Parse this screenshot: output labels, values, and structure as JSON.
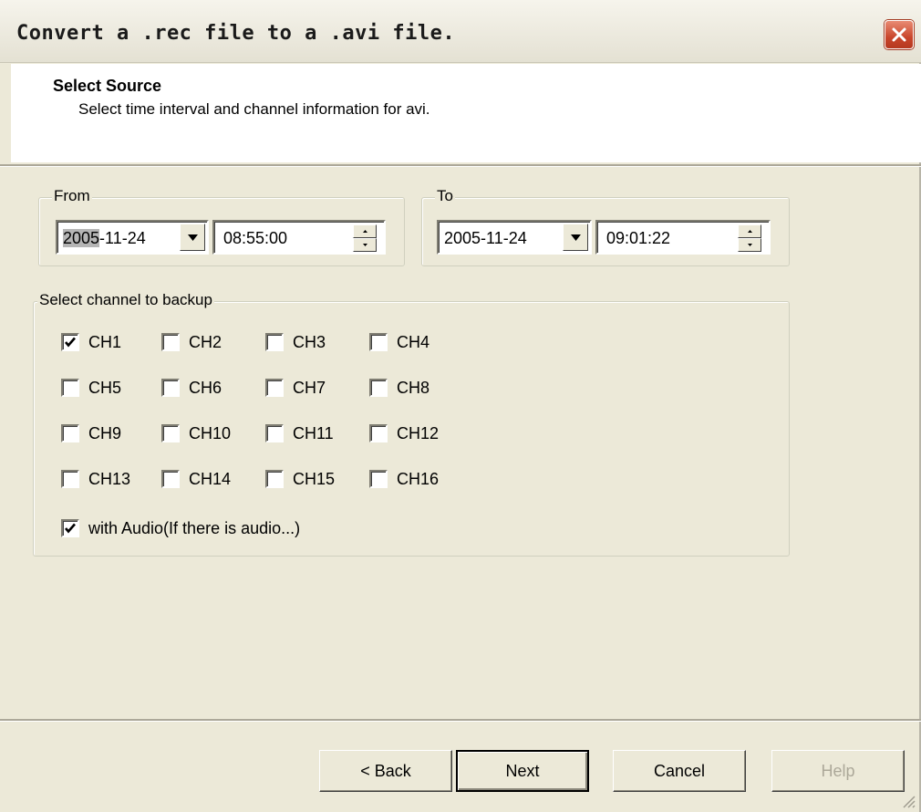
{
  "window": {
    "title": "Convert a .rec file to a .avi file.",
    "close_icon": "close-icon"
  },
  "header": {
    "title": "Select Source",
    "subtitle": "Select time interval and channel information for avi."
  },
  "from": {
    "label": "From",
    "date_year": "2005",
    "date_rest": "-11-24",
    "time": "08:55:00"
  },
  "to": {
    "label": "To",
    "date": "2005-11-24",
    "time": "09:01:22"
  },
  "channels": {
    "label": "Select channel to backup",
    "items": [
      {
        "label": "CH1",
        "checked": true
      },
      {
        "label": "CH2",
        "checked": false
      },
      {
        "label": "CH3",
        "checked": false
      },
      {
        "label": "CH4",
        "checked": false
      },
      {
        "label": "CH5",
        "checked": false
      },
      {
        "label": "CH6",
        "checked": false
      },
      {
        "label": "CH7",
        "checked": false
      },
      {
        "label": "CH8",
        "checked": false
      },
      {
        "label": "CH9",
        "checked": false
      },
      {
        "label": "CH10",
        "checked": false
      },
      {
        "label": "CH11",
        "checked": false
      },
      {
        "label": "CH12",
        "checked": false
      },
      {
        "label": "CH13",
        "checked": false
      },
      {
        "label": "CH14",
        "checked": false
      },
      {
        "label": "CH15",
        "checked": false
      },
      {
        "label": "CH16",
        "checked": false
      }
    ],
    "audio": {
      "label": "with Audio(If there is audio...)",
      "checked": true
    }
  },
  "buttons": {
    "back": "< Back",
    "next": "Next",
    "cancel": "Cancel",
    "help": "Help"
  },
  "colors": {
    "dialog_bg": "#ece9d8",
    "close_button": "#c9462c",
    "disabled_text": "#aca899"
  }
}
